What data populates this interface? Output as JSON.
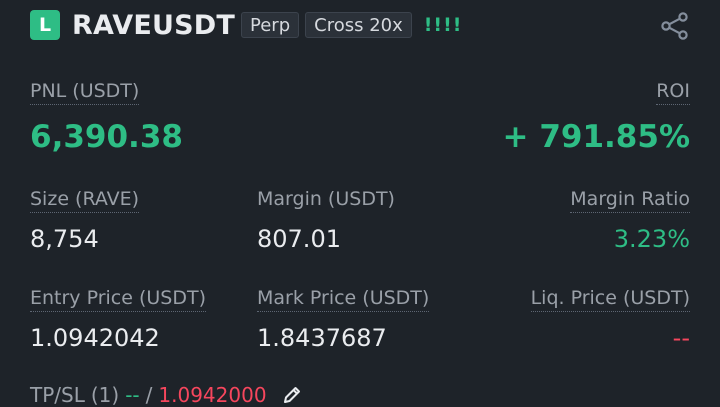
{
  "header": {
    "side": "L",
    "symbol": "RAVEUSDT",
    "contract_type": "Perp",
    "margin_mode": "Cross 20x",
    "strength": "!!!!"
  },
  "pnl": {
    "label": "PNL (USDT)",
    "value": "6,390.38"
  },
  "roi": {
    "label": "ROI",
    "value": "+ 791.85%"
  },
  "size": {
    "label": "Size (RAVE)",
    "value": "8,754"
  },
  "margin": {
    "label": "Margin (USDT)",
    "value": "807.01"
  },
  "margin_ratio": {
    "label": "Margin Ratio",
    "value": "3.23%"
  },
  "entry_price": {
    "label": "Entry Price (USDT)",
    "value": "1.0942042"
  },
  "mark_price": {
    "label": "Mark Price (USDT)",
    "value": "1.8437687"
  },
  "liq_price": {
    "label": "Liq. Price (USDT)",
    "value": "--"
  },
  "tpsl": {
    "label": "TP/SL",
    "count": "(1)",
    "tp": "--",
    "separator": "/",
    "sl": "1.0942000"
  },
  "colors": {
    "background": "#1e2329",
    "positive": "#2ebd85",
    "negative": "#f6465d",
    "muted": "#9aa0a8"
  },
  "icons": {
    "share": "share-icon",
    "edit": "pencil-icon"
  }
}
